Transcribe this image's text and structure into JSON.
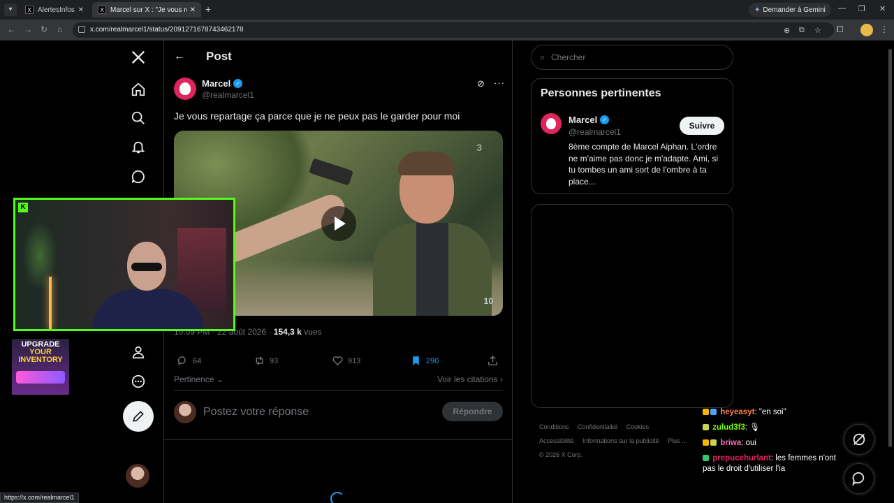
{
  "browser": {
    "tabs": [
      {
        "title": "AlertesInfos sur",
        "favicon": "X"
      },
      {
        "title": "Marcel sur X : \"Je vous repartag",
        "favicon": "X"
      }
    ],
    "new_tab": "+",
    "gemini_label": "Demander à Gemini",
    "url": "x.com/realmarcel1/status/2091271678743462178",
    "status_url": "https://x.com/realmarcel1"
  },
  "nav": {
    "logo": "X",
    "items": [
      "home-icon",
      "search-icon",
      "notifications-icon",
      "messages-icon",
      "profile-icon",
      "more-icon"
    ]
  },
  "post": {
    "header_title": "Post",
    "author": {
      "name": "Marcel",
      "handle": "@realmarcel1",
      "verified": true
    },
    "text": "Je vous repartage ça parce que je ne peux pas le garder pour moi",
    "meta": {
      "time": "10:09 PM",
      "date": "22 août 2026",
      "views_count": "154,3 k",
      "views_label": "vues"
    },
    "stats": {
      "replies": "64",
      "reposts": "93",
      "likes": "913",
      "bookmarks": "290"
    },
    "sort_label": "Pertinence",
    "quotes_label": "Voir les citations",
    "reply_placeholder": "Postez votre réponse",
    "reply_button": "Répondre",
    "video_watermark": "10"
  },
  "sidebar": {
    "search_placeholder": "Chercher",
    "relevant_title": "Personnes pertinentes",
    "person": {
      "name": "Marcel",
      "handle": "@realmarcel1",
      "follow_label": "Suivre",
      "bio": "8ème compte de Marcel Aiphan. L'ordre ne m'aime pas donc je m'adapte. Ami, si tu tombes un ami sort de l'ombre à ta place..."
    },
    "footer": [
      "Conditions",
      "Confidentialité",
      "Cookies",
      "Accessibilité",
      "Informations sur la publicité",
      "Plus ...",
      "© 2026 X Corp."
    ]
  },
  "overlay": {
    "promo": {
      "line1": "UPGRADE",
      "line2": "YOUR",
      "line3": "INVENTORY"
    },
    "chat": [
      {
        "user": "heyeasyt",
        "text": ": \"en soi\"",
        "color": "#ff7f50"
      },
      {
        "user": "zulud3f3",
        "text": ":",
        "color": "#7cfc00"
      },
      {
        "user": "briwa",
        "text": ": oui",
        "color": "#ff69b4"
      },
      {
        "user": "prepucehurlant",
        "text": ": les femmes n'ont pas le droit d'utiliser l'ia",
        "color": "#e0245e"
      }
    ]
  },
  "colors": {
    "accent": "#1d9bf0",
    "kick_green": "#53fc18"
  }
}
